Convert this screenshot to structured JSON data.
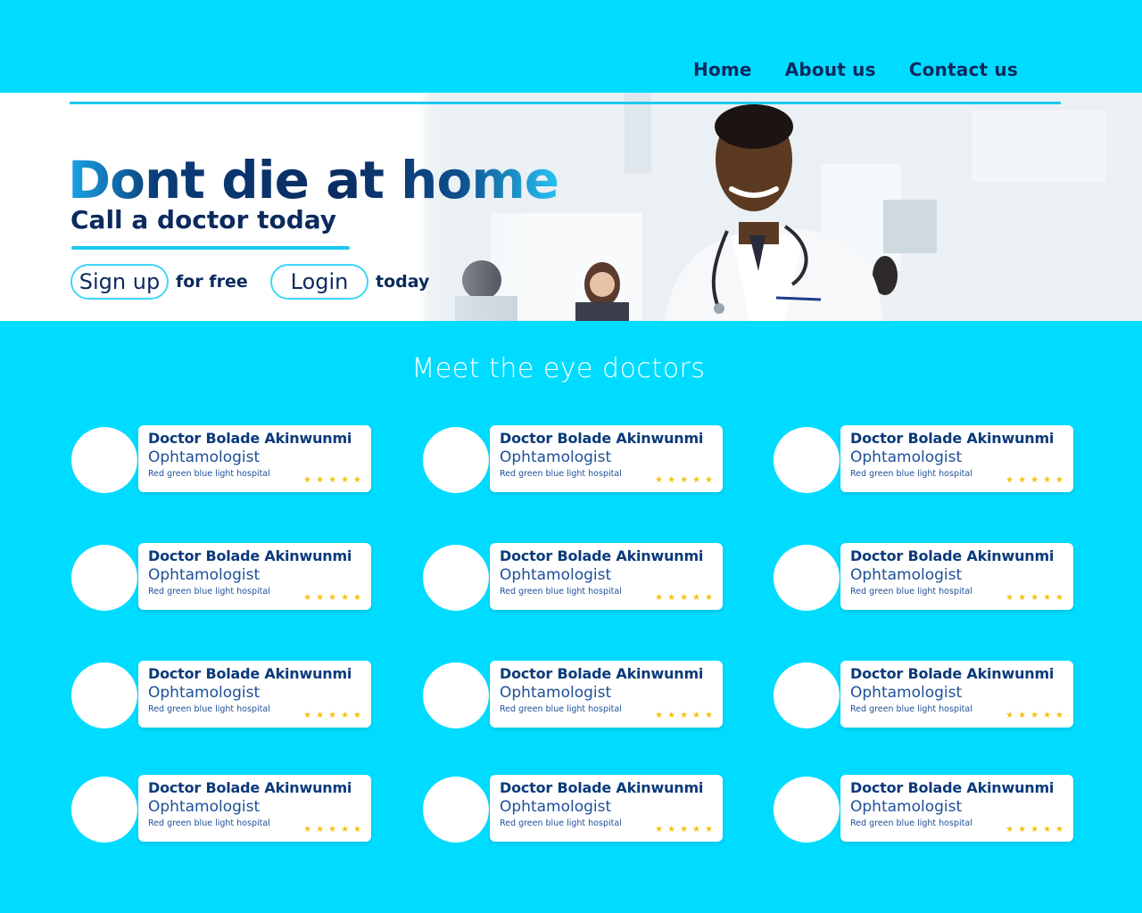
{
  "nav": {
    "items": [
      "Home",
      "About us",
      "Contact us"
    ]
  },
  "hero": {
    "title": "Dont die at home",
    "subtitle": "Call a doctor today",
    "signup_label": "Sign up",
    "signup_note": "for free",
    "login_label": "Login",
    "login_note": "today"
  },
  "section": {
    "title": "Meet the eye doctors"
  },
  "doctors": [
    {
      "name": "Doctor Bolade Akinwunmi",
      "role": "Ophtamologist",
      "hospital": "Red green blue light hospital",
      "stars": "★★★★★"
    },
    {
      "name": "Doctor Bolade Akinwunmi",
      "role": "Ophtamologist",
      "hospital": "Red green blue light hospital",
      "stars": "★★★★★"
    },
    {
      "name": "Doctor Bolade Akinwunmi",
      "role": "Ophtamologist",
      "hospital": "Red green blue light hospital",
      "stars": "★★★★★"
    },
    {
      "name": "Doctor Bolade Akinwunmi",
      "role": "Ophtamologist",
      "hospital": "Red green blue light hospital",
      "stars": "★★★★★"
    },
    {
      "name": "Doctor Bolade Akinwunmi",
      "role": "Ophtamologist",
      "hospital": "Red green blue light hospital",
      "stars": "★★★★★"
    },
    {
      "name": "Doctor Bolade Akinwunmi",
      "role": "Ophtamologist",
      "hospital": "Red green blue light hospital",
      "stars": "★★★★★"
    },
    {
      "name": "Doctor Bolade Akinwunmi",
      "role": "Ophtamologist",
      "hospital": "Red green blue light hospital",
      "stars": "★★★★★"
    },
    {
      "name": "Doctor Bolade Akinwunmi",
      "role": "Ophtamologist",
      "hospital": "Red green blue light hospital",
      "stars": "★★★★★"
    },
    {
      "name": "Doctor Bolade Akinwunmi",
      "role": "Ophtamologist",
      "hospital": "Red green blue light hospital",
      "stars": "★★★★★"
    },
    {
      "name": "Doctor Bolade Akinwunmi",
      "role": "Ophtamologist",
      "hospital": "Red green blue light hospital",
      "stars": "★★★★★"
    },
    {
      "name": "Doctor Bolade Akinwunmi",
      "role": "Ophtamologist",
      "hospital": "Red green blue light hospital",
      "stars": "★★★★★"
    },
    {
      "name": "Doctor Bolade Akinwunmi",
      "role": "Ophtamologist",
      "hospital": "Red green blue light hospital",
      "stars": "★★★★★"
    }
  ],
  "colors": {
    "background": "#00dcff",
    "navy": "#0b2a5e",
    "accent": "#1dc9f0",
    "star": "#f4c20d"
  }
}
